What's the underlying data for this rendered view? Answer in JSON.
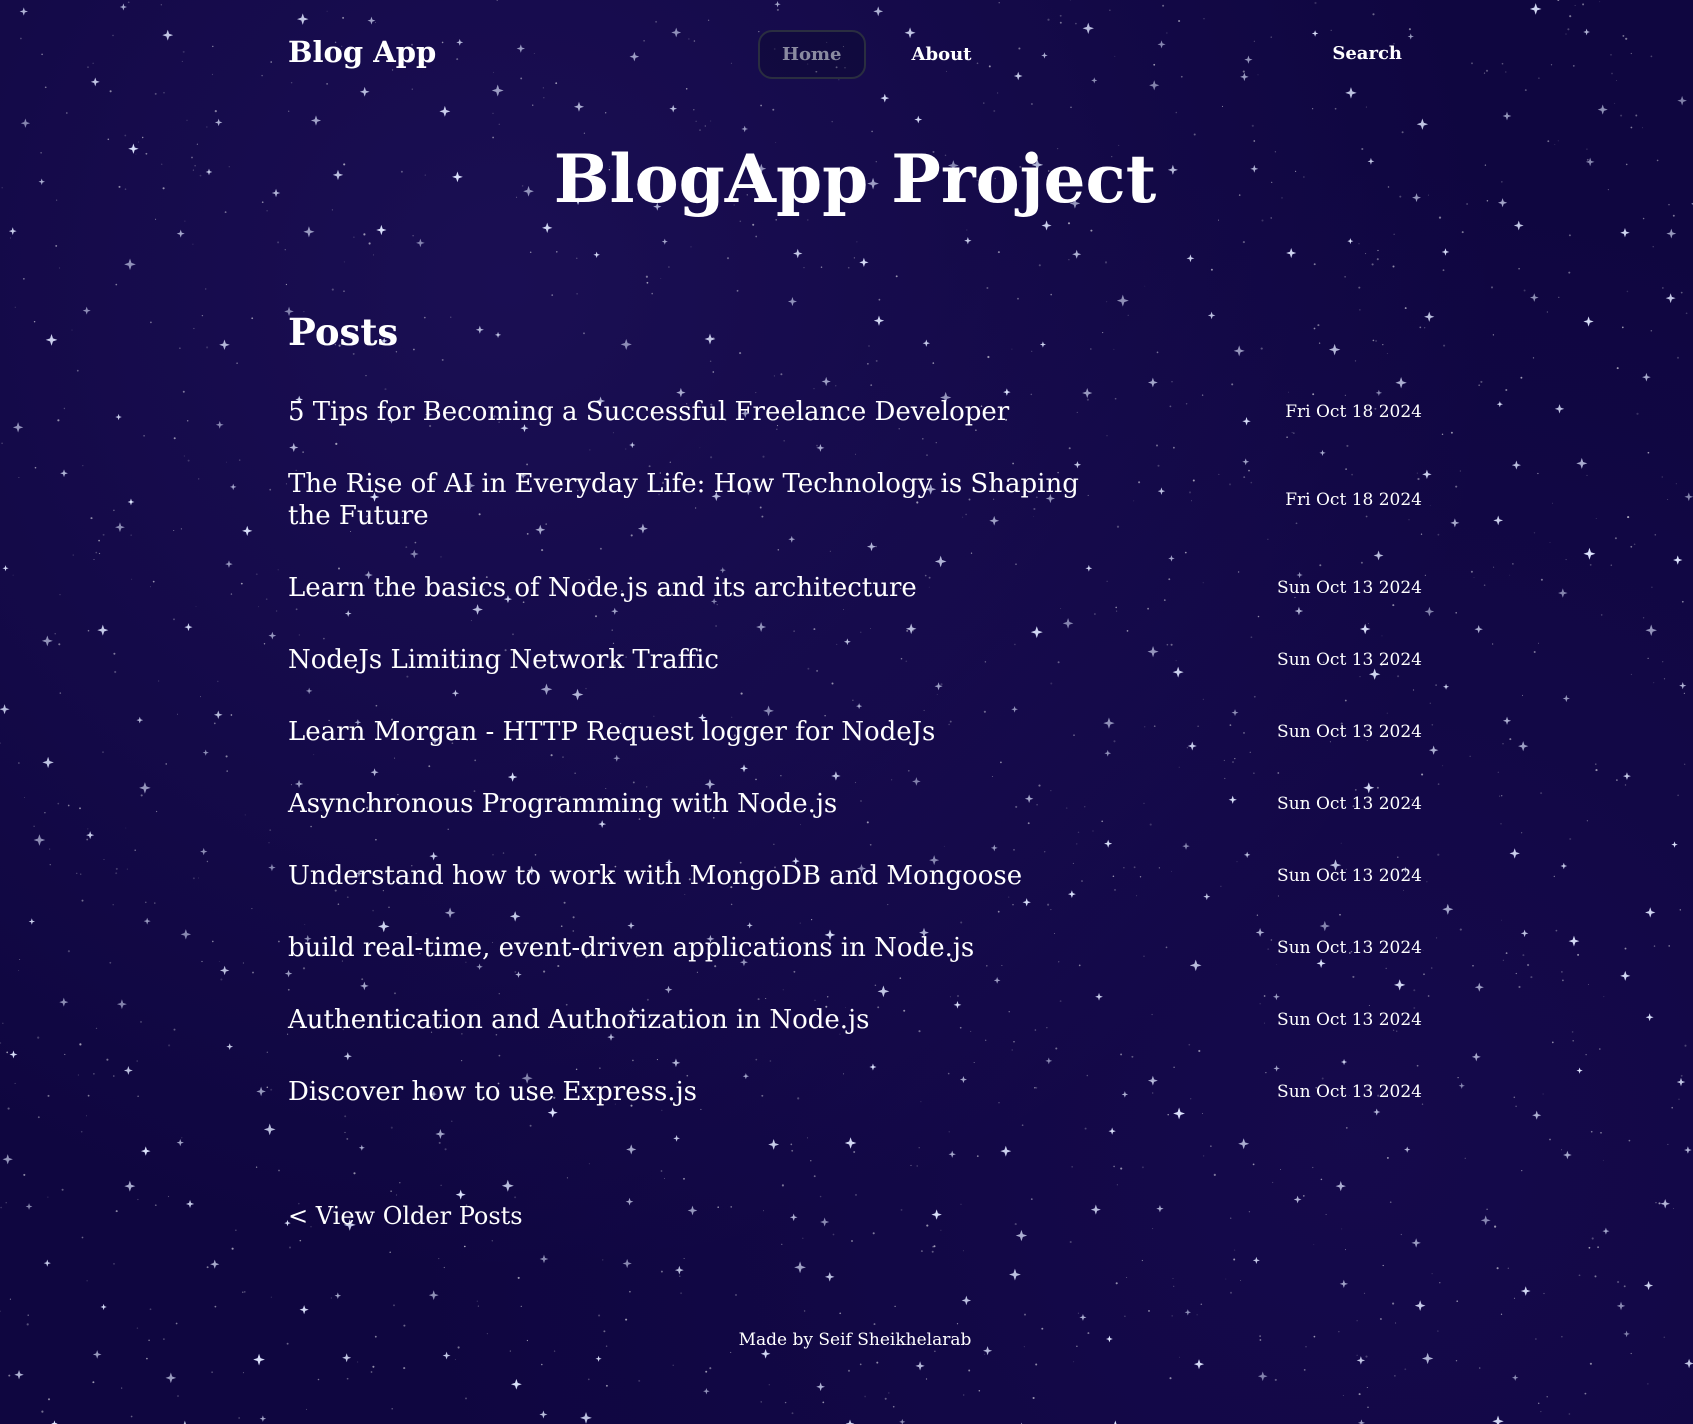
{
  "header": {
    "logo": "Blog App",
    "nav": [
      {
        "label": "Home",
        "active": true
      },
      {
        "label": "About",
        "active": false
      }
    ],
    "search_label": "Search"
  },
  "hero": {
    "title": "BlogApp Project"
  },
  "posts": {
    "heading": "Posts",
    "items": [
      {
        "title": "5 Tips for Becoming a Successful Freelance Developer",
        "date": "Fri Oct 18 2024"
      },
      {
        "title": "The Rise of AI in Everyday Life: How Technology is Shaping the Future",
        "date": "Fri Oct 18 2024"
      },
      {
        "title": "Learn the basics of Node.js and its architecture",
        "date": "Sun Oct 13 2024"
      },
      {
        "title": "NodeJs Limiting Network Traffic",
        "date": "Sun Oct 13 2024"
      },
      {
        "title": "Learn Morgan - HTTP Request logger for NodeJs",
        "date": "Sun Oct 13 2024"
      },
      {
        "title": "Asynchronous Programming with Node.js",
        "date": "Sun Oct 13 2024"
      },
      {
        "title": "Understand how to work with MongoDB and Mongoose",
        "date": "Sun Oct 13 2024"
      },
      {
        "title": "build real-time, event-driven applications in Node.js",
        "date": "Sun Oct 13 2024"
      },
      {
        "title": "Authentication and Authorization in Node.js",
        "date": "Sun Oct 13 2024"
      },
      {
        "title": "Discover how to use Express.js",
        "date": "Sun Oct 13 2024"
      }
    ],
    "older_link": "< View Older Posts"
  },
  "footer": {
    "text": "Made by Seif Sheikhelarab"
  },
  "colors": {
    "background": "#0f0640",
    "text": "#ffffff",
    "nav_active_text": "#8a8aa0"
  }
}
